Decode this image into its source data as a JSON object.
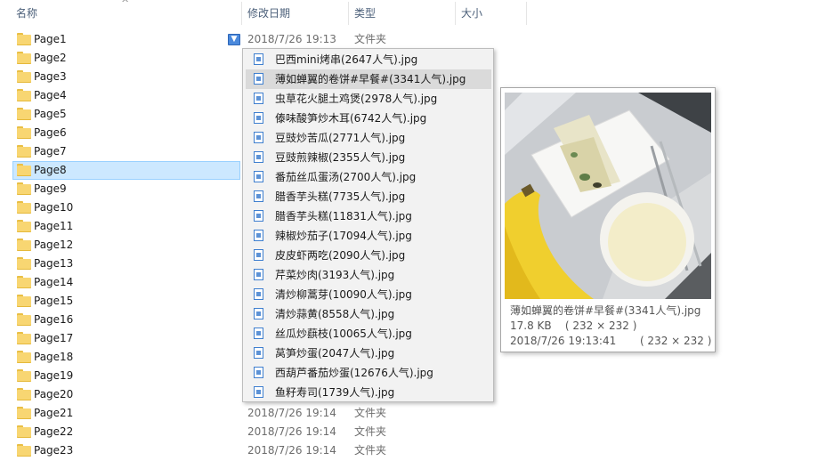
{
  "header": {
    "col_name": "名称",
    "col_date": "修改日期",
    "col_type": "类型",
    "col_size": "大小"
  },
  "rows": [
    {
      "name": "Page1",
      "date": "2018/7/26 19:13",
      "type": "文件夹"
    },
    {
      "name": "Page2",
      "date": "",
      "type": ""
    },
    {
      "name": "Page3",
      "date": "",
      "type": ""
    },
    {
      "name": "Page4",
      "date": "",
      "type": ""
    },
    {
      "name": "Page5",
      "date": "",
      "type": ""
    },
    {
      "name": "Page6",
      "date": "",
      "type": ""
    },
    {
      "name": "Page7",
      "date": "",
      "type": ""
    },
    {
      "name": "Page8",
      "date": "",
      "type": "",
      "selected": true
    },
    {
      "name": "Page9",
      "date": "",
      "type": ""
    },
    {
      "name": "Page10",
      "date": "",
      "type": ""
    },
    {
      "name": "Page11",
      "date": "",
      "type": ""
    },
    {
      "name": "Page12",
      "date": "",
      "type": ""
    },
    {
      "name": "Page13",
      "date": "",
      "type": ""
    },
    {
      "name": "Page14",
      "date": "",
      "type": ""
    },
    {
      "name": "Page15",
      "date": "",
      "type": ""
    },
    {
      "name": "Page16",
      "date": "",
      "type": ""
    },
    {
      "name": "Page17",
      "date": "",
      "type": ""
    },
    {
      "name": "Page18",
      "date": "",
      "type": ""
    },
    {
      "name": "Page19",
      "date": "",
      "type": ""
    },
    {
      "name": "Page20",
      "date": "",
      "type": ""
    },
    {
      "name": "Page21",
      "date": "2018/7/26 19:14",
      "type": "文件夹"
    },
    {
      "name": "Page22",
      "date": "2018/7/26 19:14",
      "type": "文件夹"
    },
    {
      "name": "Page23",
      "date": "2018/7/26 19:14",
      "type": "文件夹"
    }
  ],
  "dropdown": {
    "items": [
      "巴西mini烤串(2647人气).jpg",
      "薄如蝉翼的卷饼#早餐#(3341人气).jpg",
      "虫草花火腿土鸡煲(2978人气).jpg",
      "傣味酸笋炒木耳(6742人气).jpg",
      "豆豉炒苦瓜(2771人气).jpg",
      "豆豉煎辣椒(2355人气).jpg",
      "番茄丝瓜蛋汤(2700人气).jpg",
      "腊香芋头糕(7735人气).jpg",
      "腊香芋头糕(11831人气).jpg",
      "辣椒炒茄子(17094人气).jpg",
      "皮皮虾两吃(2090人气).jpg",
      "芹菜炒肉(3193人气).jpg",
      "清炒柳蒿芽(10090人气).jpg",
      "清炒蒜黄(8558人气).jpg",
      "丝瓜炒蕻枝(10065人气).jpg",
      "莴笋炒蛋(2047人气).jpg",
      "西葫芦番茄炒蛋(12676人气).jpg",
      "鱼籽寿司(1739人气).jpg"
    ],
    "hover_index": 1
  },
  "preview": {
    "filename": "薄如蝉翼的卷饼#早餐#(3341人气).jpg",
    "size_line": "17.8 KB    ( 232 × 232 )",
    "date_line": "2018/7/26 19:13:41       ( 232 × 232 )"
  },
  "colors": {
    "selection_bg": "#cce8ff",
    "selection_border": "#99d1ff",
    "header_text": "#4c607a",
    "folder_yellow": "#f8d672",
    "icon_blue": "#3f7fcf"
  }
}
